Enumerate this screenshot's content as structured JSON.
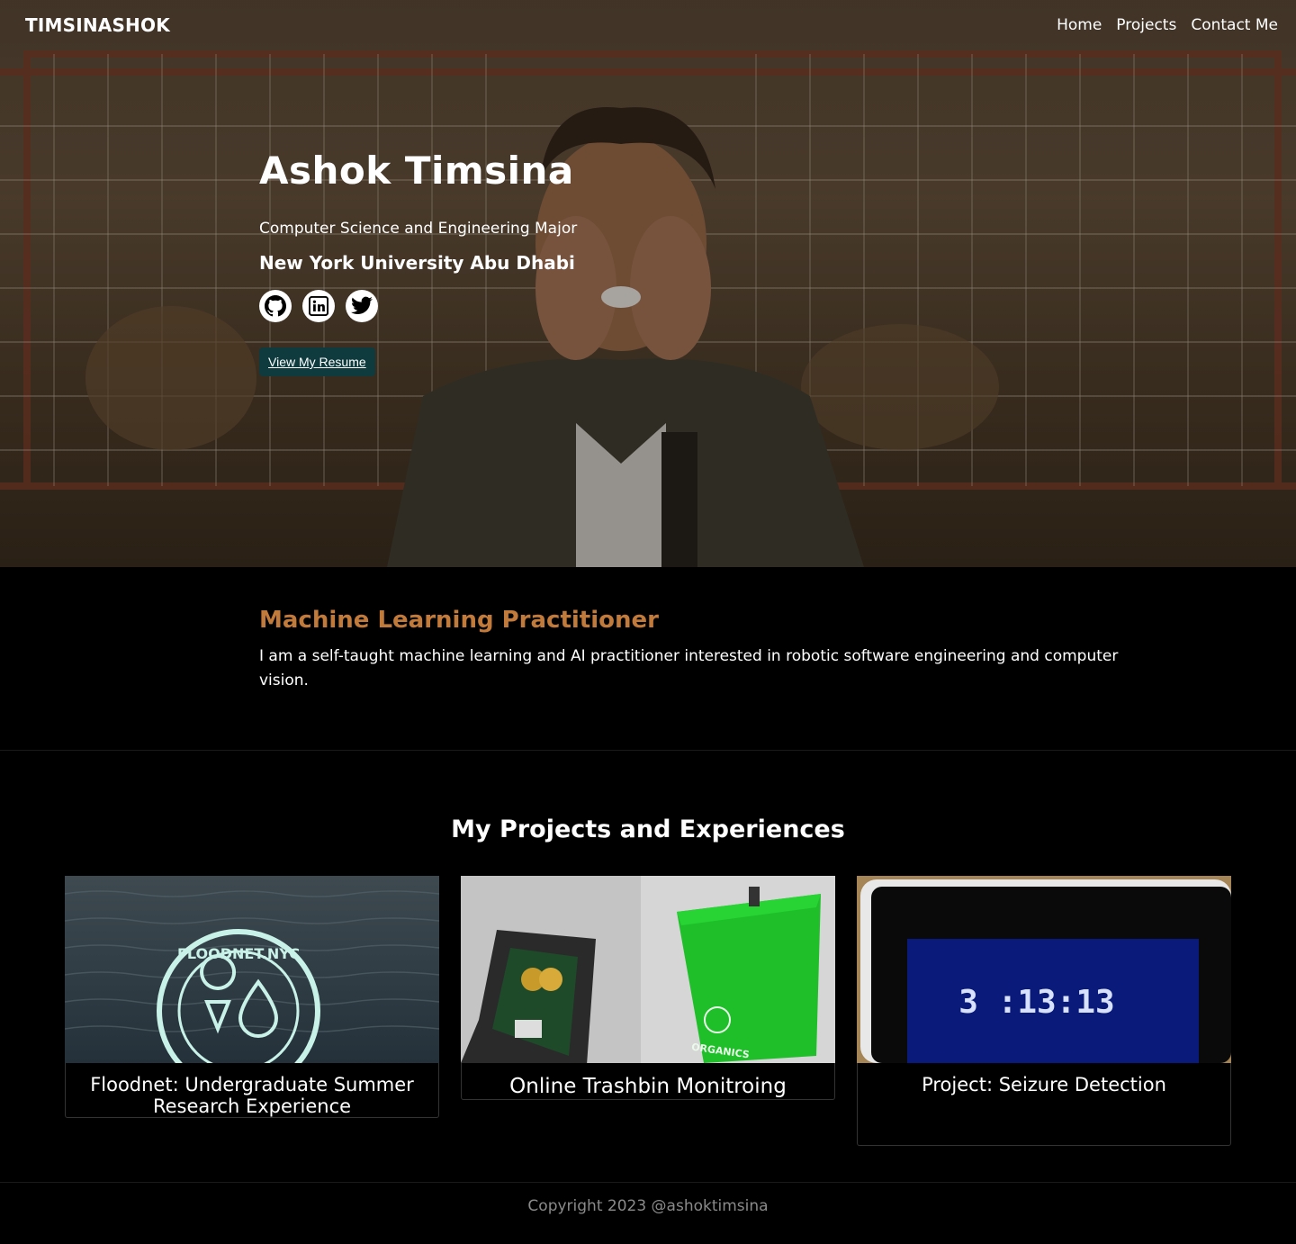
{
  "nav": {
    "brand": "TIMSINASHOK",
    "links": [
      "Home",
      "Projects",
      "Contact Me"
    ]
  },
  "hero": {
    "name": "Ashok Timsina",
    "subtitle": "Computer Science and Engineering Major",
    "school": "New York University Abu Dhabi",
    "socials": [
      "github-icon",
      "linkedin-icon",
      "twitter-icon"
    ],
    "resume_label": "View My Resume"
  },
  "about": {
    "heading": "Machine Learning Practitioner",
    "text": "I am a self-taught machine learning and AI practitioner interested in robotic software engineering and computer vision.",
    "heading_color": "#c27a3a"
  },
  "projects": {
    "heading": "My Projects and Experiences",
    "cards": [
      {
        "title": "Floodnet: Undergraduate Summer Research Experience",
        "logo_text": "FLOODNET.NYC"
      },
      {
        "title": "Online Trashbin Monitroing",
        "bin_label": "ORGANICS"
      },
      {
        "title": "Project: Seizure Detection",
        "clock": "3 :13:13"
      }
    ]
  },
  "footer": {
    "text": "Copyright 2023 @ashoktimsina"
  },
  "colors": {
    "resume_button": "#0f3b3e",
    "background": "#000000"
  }
}
